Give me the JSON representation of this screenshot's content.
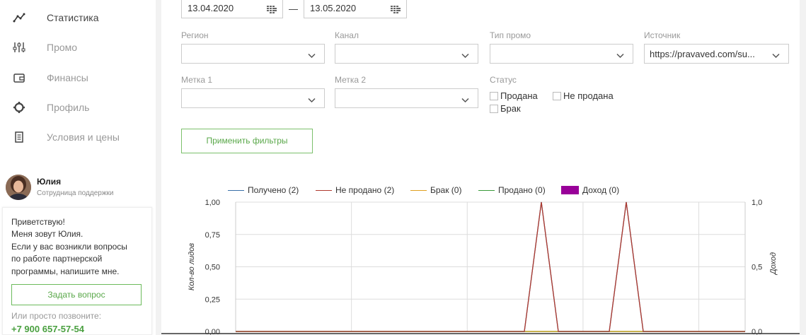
{
  "sidebar": {
    "items": [
      {
        "label": "Статистика",
        "icon": "stats-line-icon",
        "active": true
      },
      {
        "label": "Промо",
        "icon": "sliders-icon",
        "active": false
      },
      {
        "label": "Финансы",
        "icon": "wallet-icon",
        "active": false
      },
      {
        "label": "Профиль",
        "icon": "gear-icon",
        "active": false
      },
      {
        "label": "Условия и цены",
        "icon": "document-icon",
        "active": false
      }
    ],
    "user": {
      "name": "Юлия",
      "role": "Сотрудница поддержки"
    },
    "support": {
      "message": "Приветствую!\nМеня зовут Юлия.\nЕсли у вас возникли вопросы по работе партнерской программы, напишите мне.",
      "ask_button": "Задать вопрос",
      "call_text": "Или просто позвоните:",
      "phone": "+7 900 657-57-54"
    }
  },
  "filters": {
    "date_from": "13.04.2020",
    "date_separator": "—",
    "date_to": "13.05.2020",
    "region": {
      "label": "Регион",
      "value": ""
    },
    "channel": {
      "label": "Канал",
      "value": ""
    },
    "promo_type": {
      "label": "Тип промо",
      "value": ""
    },
    "source": {
      "label": "Источник",
      "value": "https://pravaved.com/su..."
    },
    "tag1": {
      "label": "Метка 1",
      "value": ""
    },
    "tag2": {
      "label": "Метка 2",
      "value": ""
    },
    "status": {
      "label": "Статус",
      "options": [
        {
          "label": "Продана",
          "checked": false
        },
        {
          "label": "Не продана",
          "checked": false
        },
        {
          "label": "Брак",
          "checked": false
        }
      ]
    },
    "apply_button": "Применить фильтры"
  },
  "colors": {
    "received": "#3a6fa8",
    "not_sold": "#b03a2e",
    "defect": "#e0a020",
    "sold": "#3a9a3a",
    "income": "#990099",
    "accent": "#5aa84a"
  },
  "chart_data": {
    "type": "line",
    "legend": [
      {
        "name": "Получено (2)",
        "key": "received",
        "kind": "line"
      },
      {
        "name": "Не продано (2)",
        "key": "not_sold",
        "kind": "line"
      },
      {
        "name": "Брак (0)",
        "key": "defect",
        "kind": "line"
      },
      {
        "name": "Продано (0)",
        "key": "sold",
        "kind": "line"
      },
      {
        "name": "Доход (0)",
        "key": "income",
        "kind": "bar"
      }
    ],
    "ylabel": "Кол-во лидов",
    "y2label": "Доход",
    "ylim": [
      0,
      1
    ],
    "y2lim": [
      0,
      1
    ],
    "yticks": [
      "0,00",
      "0,25",
      "0,50",
      "0,75",
      "1,00"
    ],
    "y2ticks": [
      "0,0",
      "0,5",
      "1,0"
    ],
    "x_points": 31,
    "series": {
      "received": [
        0,
        0,
        0,
        0,
        0,
        0,
        0,
        0,
        0,
        0,
        0,
        0,
        0,
        0,
        0,
        0,
        0,
        0,
        1,
        0,
        0,
        0,
        0,
        1,
        0,
        0,
        0,
        0,
        0,
        0,
        0
      ],
      "not_sold": [
        0,
        0,
        0,
        0,
        0,
        0,
        0,
        0,
        0,
        0,
        0,
        0,
        0,
        0,
        0,
        0,
        0,
        0,
        1,
        0,
        0,
        0,
        0,
        1,
        0,
        0,
        0,
        0,
        0,
        0,
        0
      ],
      "defect": [
        0,
        0,
        0,
        0,
        0,
        0,
        0,
        0,
        0,
        0,
        0,
        0,
        0,
        0,
        0,
        0,
        0,
        0,
        0,
        0,
        0,
        0,
        0,
        0,
        0,
        0,
        0,
        0,
        0,
        0,
        0
      ],
      "sold": [
        0,
        0,
        0,
        0,
        0,
        0,
        0,
        0,
        0,
        0,
        0,
        0,
        0,
        0,
        0,
        0,
        0,
        0,
        0,
        0,
        0,
        0,
        0,
        0,
        0,
        0,
        0,
        0,
        0,
        0,
        0
      ]
    }
  }
}
